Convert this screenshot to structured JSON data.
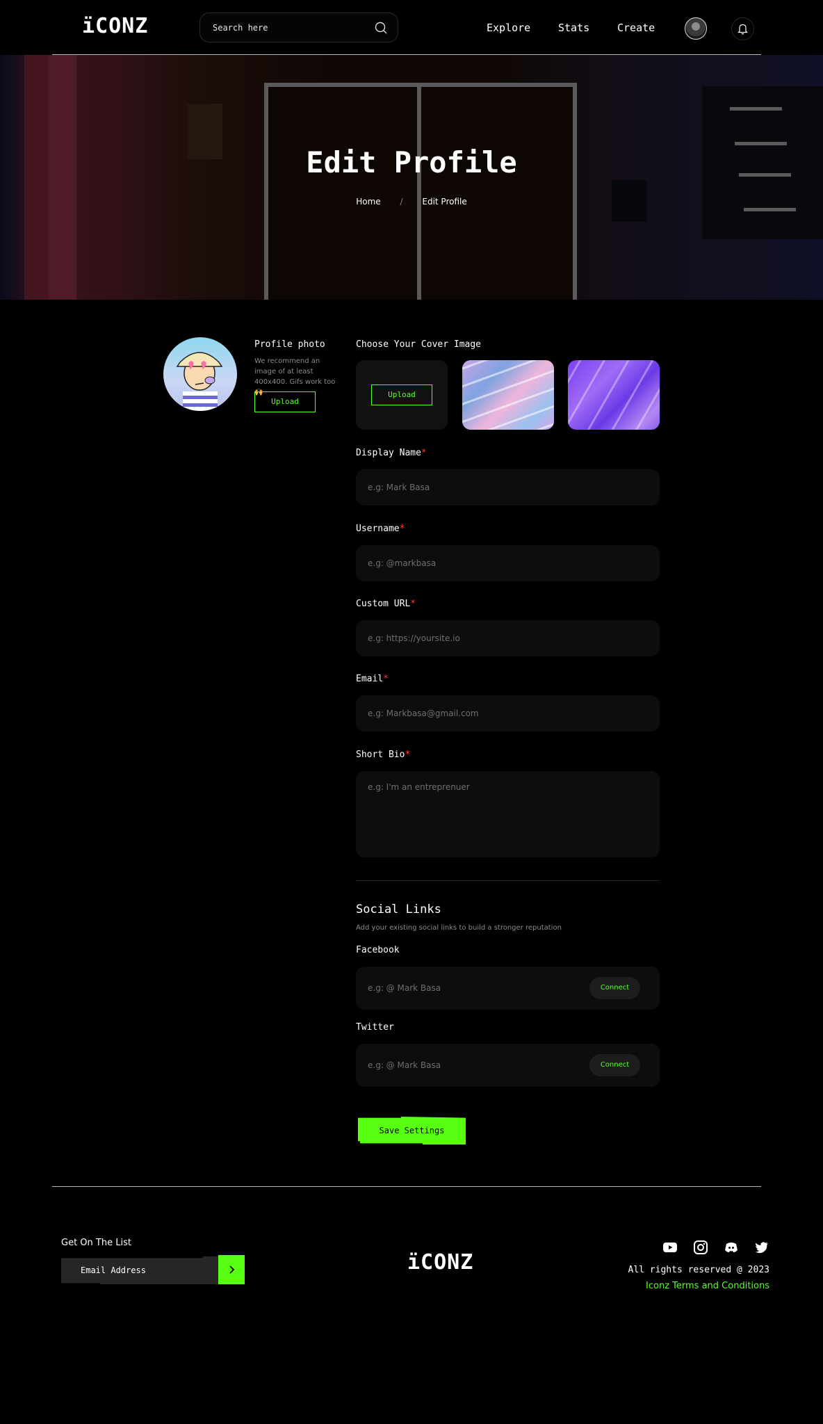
{
  "brand": {
    "logo": "ïCONZ",
    "accent": "#57ff11"
  },
  "header": {
    "search_placeholder": "Search here",
    "nav": [
      "Explore",
      "Stats",
      "Create"
    ]
  },
  "hero": {
    "title": "Edit Profile",
    "breadcrumb": {
      "home": "Home",
      "separator": "/",
      "current": "Edit Profile"
    }
  },
  "profile": {
    "label": "Profile photo",
    "hint": "We recommend an image of at least 400x400. Gifs work too 🙌",
    "upload_label": "Upload"
  },
  "cover": {
    "label": "Choose Your Cover Image",
    "upload_label": "Upload"
  },
  "form": {
    "required_mark": "*",
    "display_name": {
      "label": "Display Name",
      "placeholder": "e.g: Mark Basa"
    },
    "username": {
      "label": "Username",
      "placeholder": "e.g: @markbasa"
    },
    "custom_url": {
      "label": "Custom URL",
      "placeholder": "e.g: https://yoursite.io"
    },
    "email": {
      "label": "Email",
      "placeholder": "e.g: Markbasa@gmail.com"
    },
    "bio": {
      "label": "Short Bio",
      "placeholder": "e.g: I'm an entreprenuer"
    }
  },
  "social": {
    "title": "Social Links",
    "subtitle": "Add your existing social links to build a stronger reputation",
    "facebook": {
      "label": "Facebook",
      "placeholder": "e.g: @ Mark Basa",
      "button": "Connect"
    },
    "twitter": {
      "label": "Twitter",
      "placeholder": "e.g: @ Mark Basa",
      "button": "Connect"
    }
  },
  "save_label": "Save Settings",
  "footer": {
    "newsletter_title": "Get On The List",
    "email_placeholder": "Email Address",
    "icons": [
      "youtube-icon",
      "instagram-icon",
      "discord-icon",
      "twitter-icon"
    ],
    "rights": "All rights reserved @ 2023",
    "terms": "Iconz Terms and Conditions"
  }
}
